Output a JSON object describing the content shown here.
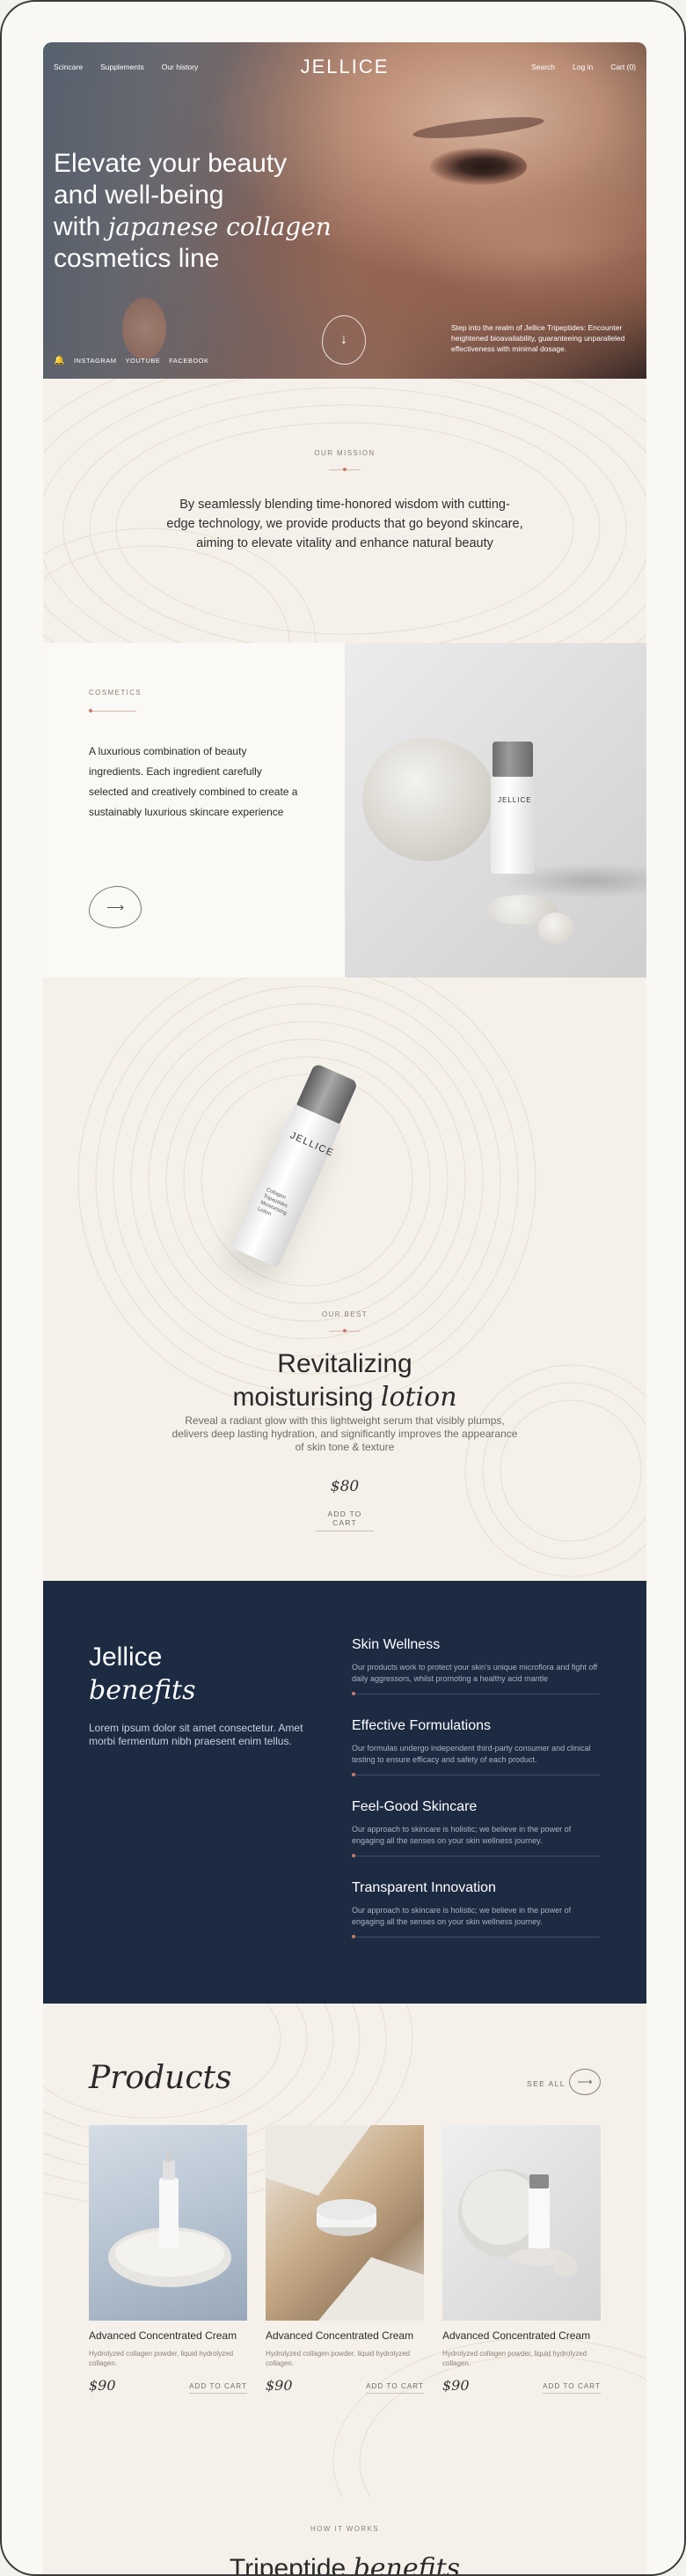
{
  "nav": {
    "links_left": [
      "Scincare",
      "Supplements",
      "Our history"
    ],
    "logo": "JELLICE",
    "search": "Search",
    "login": "Log in",
    "cart": "Cart (0)"
  },
  "hero": {
    "title_line1": "Elevate your beauty",
    "title_line2": "and well-being",
    "title_with": "with",
    "title_emph": "japanese collagen",
    "title_line4": "cosmetics line",
    "note": "Step into the realm of Jellice Tripeptides: Encounter heightened bioavailability, guaranteeing unparalleled effectiveness with minimal dosage.",
    "social": [
      "INSTAGRAM",
      "YOUTUBE",
      "FACEBOOK"
    ],
    "scroll_arrow": "↓"
  },
  "mission": {
    "overline": "OUR MISSION",
    "text": "By seamlessly blending time-honored wisdom with cutting-edge technology, we provide products that go beyond skincare, aiming to elevate vitality and enhance natural beauty"
  },
  "cosmetics": {
    "overline": "COSMETICS",
    "text": "A luxurious combination of beauty ingredients. Each ingredient carefully selected and creatively combined to create a sustainably luxurious skincare experience",
    "arrow": "⟶",
    "bottle_label": "JELLICE"
  },
  "best": {
    "overline": "OUR BEST",
    "title_line1": "Revitalizing",
    "title_word": "moisturising",
    "title_emph": "lotion",
    "description": "Reveal a radiant glow with this lightweight serum that visibly plumps, delivers deep lasting hydration, and significantly improves the appearance of skin tone & texture",
    "price": "$80",
    "cart_label": "ADD TO CART",
    "bottle_label": "JELLICE",
    "bottle_small": "Collagen Tripeptides Moisturising Lotion"
  },
  "benefits": {
    "title": "Jellice",
    "title_emph": "benefits",
    "subtitle": "Lorem ipsum dolor sit amet consectetur. Amet morbi fermentum nibh praesent enim tellus.",
    "items": [
      {
        "title": "Skin Wellness",
        "text": "Our products work to protect your skin's unique microflora and fight off daily aggressors, whilst promoting a healthy acid mantle"
      },
      {
        "title": "Effective Formulations",
        "text": "Our formulas undergo independent third-party consumer and clinical testing to ensure efficacy and safety of each product."
      },
      {
        "title": "Feel-Good Skincare",
        "text": "Our approach to skincare is holistic; we believe in the power of engaging all the senses on your skin wellness journey."
      },
      {
        "title": "Transparent Innovation",
        "text": "Our approach to skincare is holistic; we believe in the power of engaging all the senses on your skin wellness journey."
      }
    ]
  },
  "products": {
    "title": "Products",
    "see_all": "SEE ALL",
    "arrow": "⟶",
    "items": [
      {
        "name": "Advanced Concentrated Cream",
        "desc": "Hydrolyzed collagen powder, liquid hydrolyzed collagen.",
        "price": "$90",
        "cart": "ADD TO CART"
      },
      {
        "name": "Advanced Concentrated Cream",
        "desc": "Hydrolyzed collagen powder, liquid hydrolyzed collagen.",
        "price": "$90",
        "cart": "ADD TO CART"
      },
      {
        "name": "Advanced Concentrated Cream",
        "desc": "Hydrolyzed collagen powder, liquid hydrolyzed collagen.",
        "price": "$90",
        "cart": "ADD TO CART"
      }
    ]
  },
  "how": {
    "overline": "HOW IT WORKS",
    "title": "Tripeptide",
    "title_emph": "benefits"
  },
  "colors": {
    "navy": "#1c2b42",
    "cream": "#f5f1ea",
    "accent": "#c77a6a"
  }
}
